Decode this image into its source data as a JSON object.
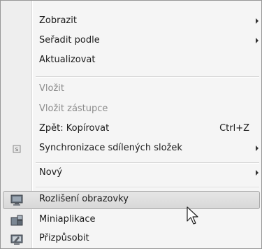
{
  "menu": {
    "items": [
      {
        "label": "Zobrazit",
        "submenu": true
      },
      {
        "label": "Seřadit podle",
        "submenu": true
      },
      {
        "label": "Aktualizovat"
      },
      {
        "label": "Vložit",
        "disabled": true
      },
      {
        "label": "Vložit zástupce",
        "disabled": true
      },
      {
        "label": "Zpět: Kopírovat",
        "shortcut": "Ctrl+Z"
      },
      {
        "label": "Synchronizace sdílených složek",
        "submenu": true,
        "icon": "sync-share-icon"
      },
      {
        "label": "Nový",
        "submenu": true
      },
      {
        "label": "Rozlišení obrazovky",
        "icon": "screen-resolution-icon",
        "highlighted": true
      },
      {
        "label": "Miniaplikace",
        "icon": "gadgets-icon"
      },
      {
        "label": "Přizpůsobit",
        "icon": "personalize-icon"
      }
    ]
  },
  "colors": {
    "highlight": "#dcdcdc",
    "disabled_text": "#8c8c8c",
    "text": "#1b1b1b"
  }
}
